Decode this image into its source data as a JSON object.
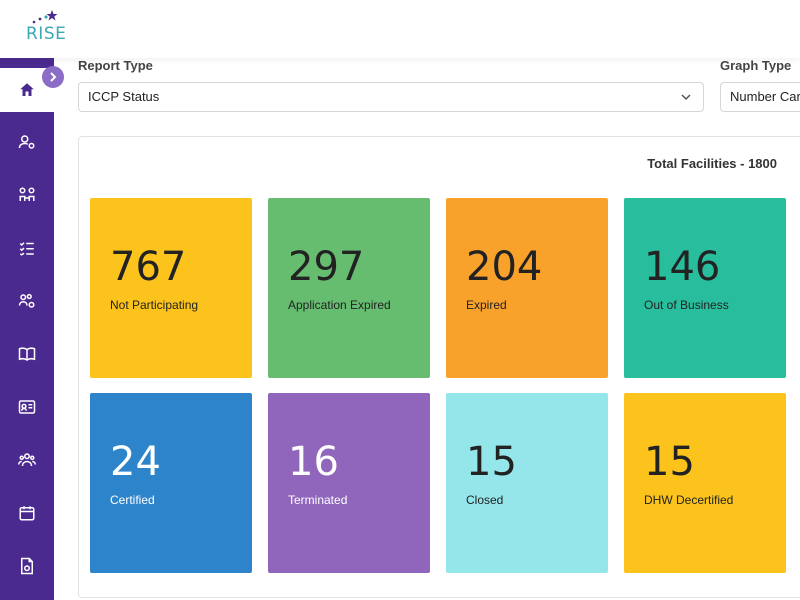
{
  "app": {
    "logo_text": "RISE"
  },
  "filters": {
    "report_type_label": "Report Type",
    "report_type_value": "ICCP Status",
    "graph_type_label": "Graph Type",
    "graph_type_value": "Number Cards"
  },
  "summary": {
    "total_label": "Total Facilities - 1800"
  },
  "cards": [
    {
      "value": "767",
      "label": "Not Participating",
      "color": "#fbc31b"
    },
    {
      "value": "297",
      "label": "Application Expired",
      "color": "#66bd6f"
    },
    {
      "value": "204",
      "label": "Expired",
      "color": "#f8a12b"
    },
    {
      "value": "146",
      "label": "Out of Business",
      "color": "#28bd9c"
    },
    {
      "value": "24",
      "label": "Certified",
      "color": "#2e84ca"
    },
    {
      "value": "16",
      "label": "Terminated",
      "color": "#8f66bc"
    },
    {
      "value": "15",
      "label": "Closed",
      "color": "#95e6ea"
    },
    {
      "value": "15",
      "label": "DHW Decertified",
      "color": "#fbc31b"
    }
  ],
  "sidebar": {
    "icons": [
      "home-icon",
      "user-settings-icon",
      "users-link-icon",
      "checklist-icon",
      "group-settings-icon",
      "book-icon",
      "id-card-icon",
      "team-icon",
      "calendar-icon",
      "document-icon"
    ]
  }
}
